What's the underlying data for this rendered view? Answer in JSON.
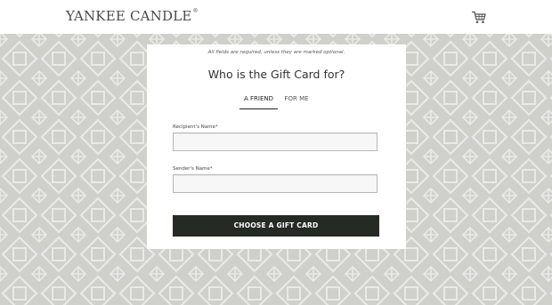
{
  "brand": {
    "logo_text": "YANKEE CANDLE",
    "trademark": "®"
  },
  "header": {
    "cart_icon": "shopping-cart-icon"
  },
  "form": {
    "required_note": "All fields are required, unless they are marked optional.",
    "title": "Who is the Gift Card for?",
    "tabs": [
      {
        "label": "A FRIEND",
        "active": true
      },
      {
        "label": "FOR ME",
        "active": false
      }
    ],
    "recipient_label": "Recipient's Name*",
    "recipient_value": "",
    "sender_label": "Sender's Name*",
    "sender_value": "",
    "submit_label": "CHOOSE A GIFT CARD"
  },
  "colors": {
    "background_pattern": "#cfcfcc",
    "button": "#252a24",
    "brand_text": "#4a4a4a"
  }
}
